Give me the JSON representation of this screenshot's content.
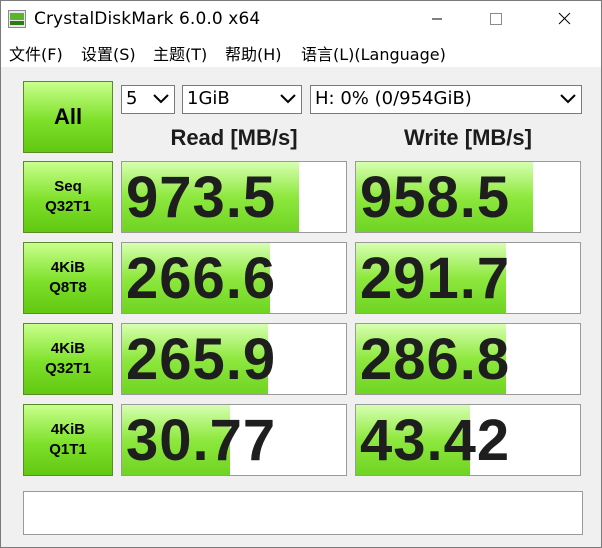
{
  "window": {
    "title": "CrystalDiskMark 6.0.0 x64",
    "icon": "crystaldiskmark-app-icon"
  },
  "menu": [
    "文件(F)",
    "设置(S)",
    "主题(T)",
    "帮助(H)",
    "语言(L)(Language)"
  ],
  "controls": {
    "all_label": "All",
    "count": "5",
    "size": "1GiB",
    "drive": "H: 0% (0/954GiB)"
  },
  "headers": {
    "read": "Read [MB/s]",
    "write": "Write [MB/s]"
  },
  "rows": [
    {
      "line1": "Seq",
      "line2": "Q32T1",
      "read": "973.5",
      "write": "958.5",
      "read_fill": 0.79,
      "write_fill": 0.79
    },
    {
      "line1": "4KiB",
      "line2": "Q8T8",
      "read": "266.6",
      "write": "291.7",
      "read_fill": 0.66,
      "write_fill": 0.67
    },
    {
      "line1": "4KiB",
      "line2": "Q32T1",
      "read": "265.9",
      "write": "286.8",
      "read_fill": 0.65,
      "write_fill": 0.67
    },
    {
      "line1": "4KiB",
      "line2": "Q1T1",
      "read": "30.77",
      "write": "43.42",
      "read_fill": 0.48,
      "write_fill": 0.51
    }
  ],
  "status_text": "",
  "colors": {
    "green_top": "#c8ff8c",
    "green_bottom": "#62c812",
    "bar_green": "#8ee83e"
  }
}
